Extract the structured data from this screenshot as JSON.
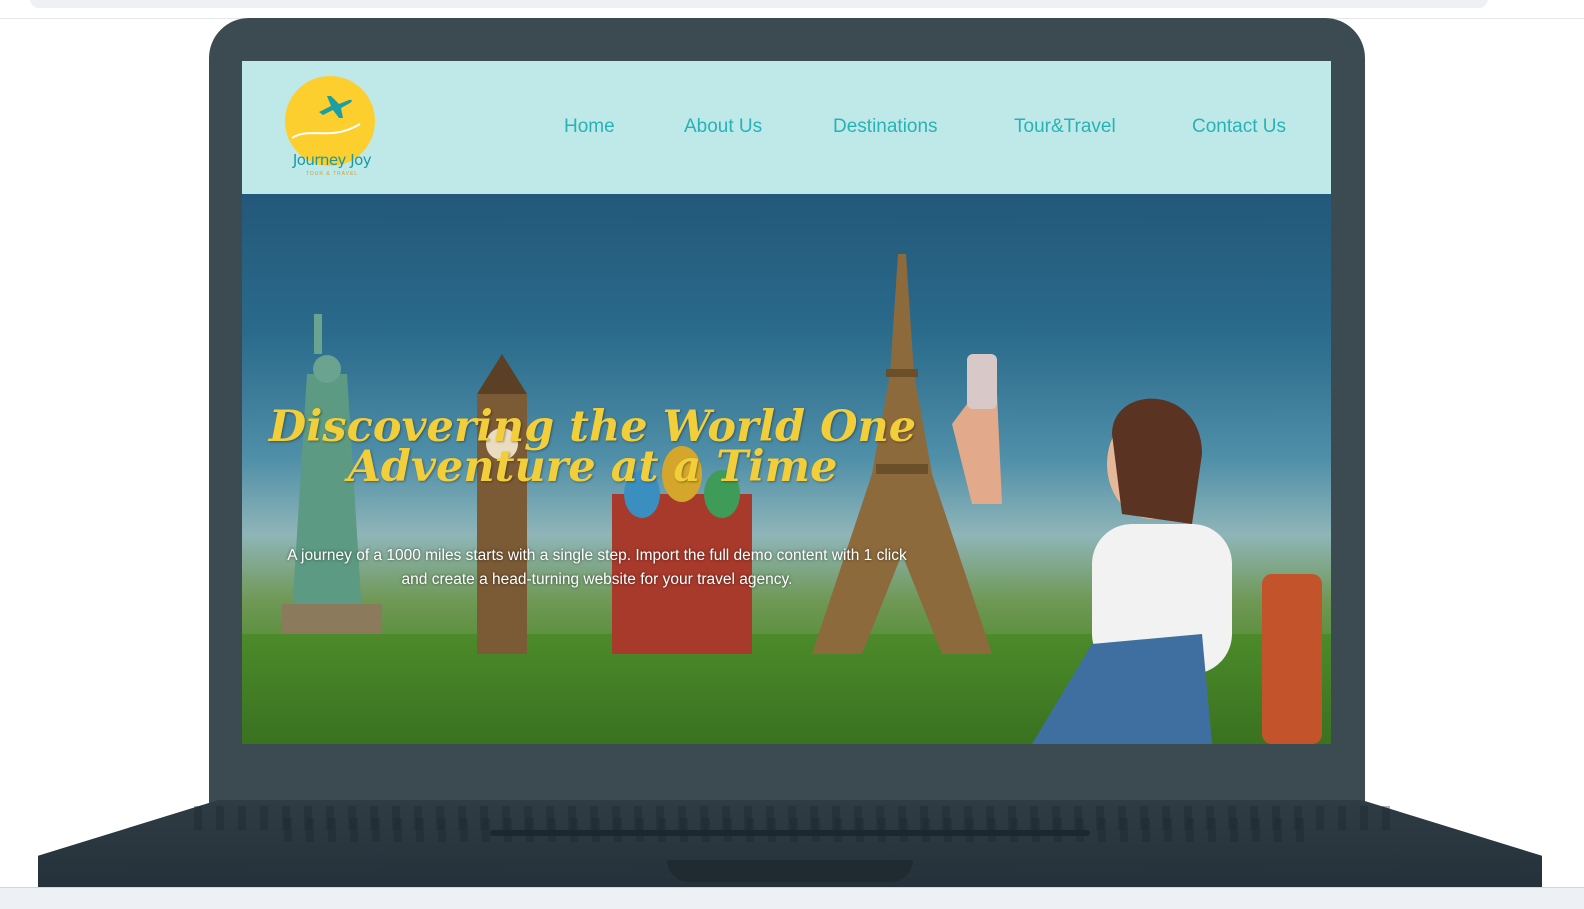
{
  "site": {
    "logo": {
      "name": "Journey Joy",
      "tagline": "TOUR & TRAVEL"
    },
    "nav": [
      {
        "label": "Home"
      },
      {
        "label": "About Us"
      },
      {
        "label": "Destinations"
      },
      {
        "label": "Tour&Travel"
      },
      {
        "label": "Contact Us"
      }
    ],
    "hero": {
      "headline_line1": "Discovering the World One",
      "headline_line2": "Adventure at a Time",
      "subtext_line1": "A journey of a 1000 miles starts with a single step. Import the full demo content with 1 click",
      "subtext_line2": "and create a head-turning website for your travel agency."
    }
  },
  "colors": {
    "nav_background": "#bee9e8",
    "nav_text": "#27b3b6",
    "logo_sun": "#fccf2e",
    "headline": "#f2cf3a",
    "laptop_frame": "#3c4a52"
  },
  "icons": {
    "logo": "airplane-icon"
  }
}
